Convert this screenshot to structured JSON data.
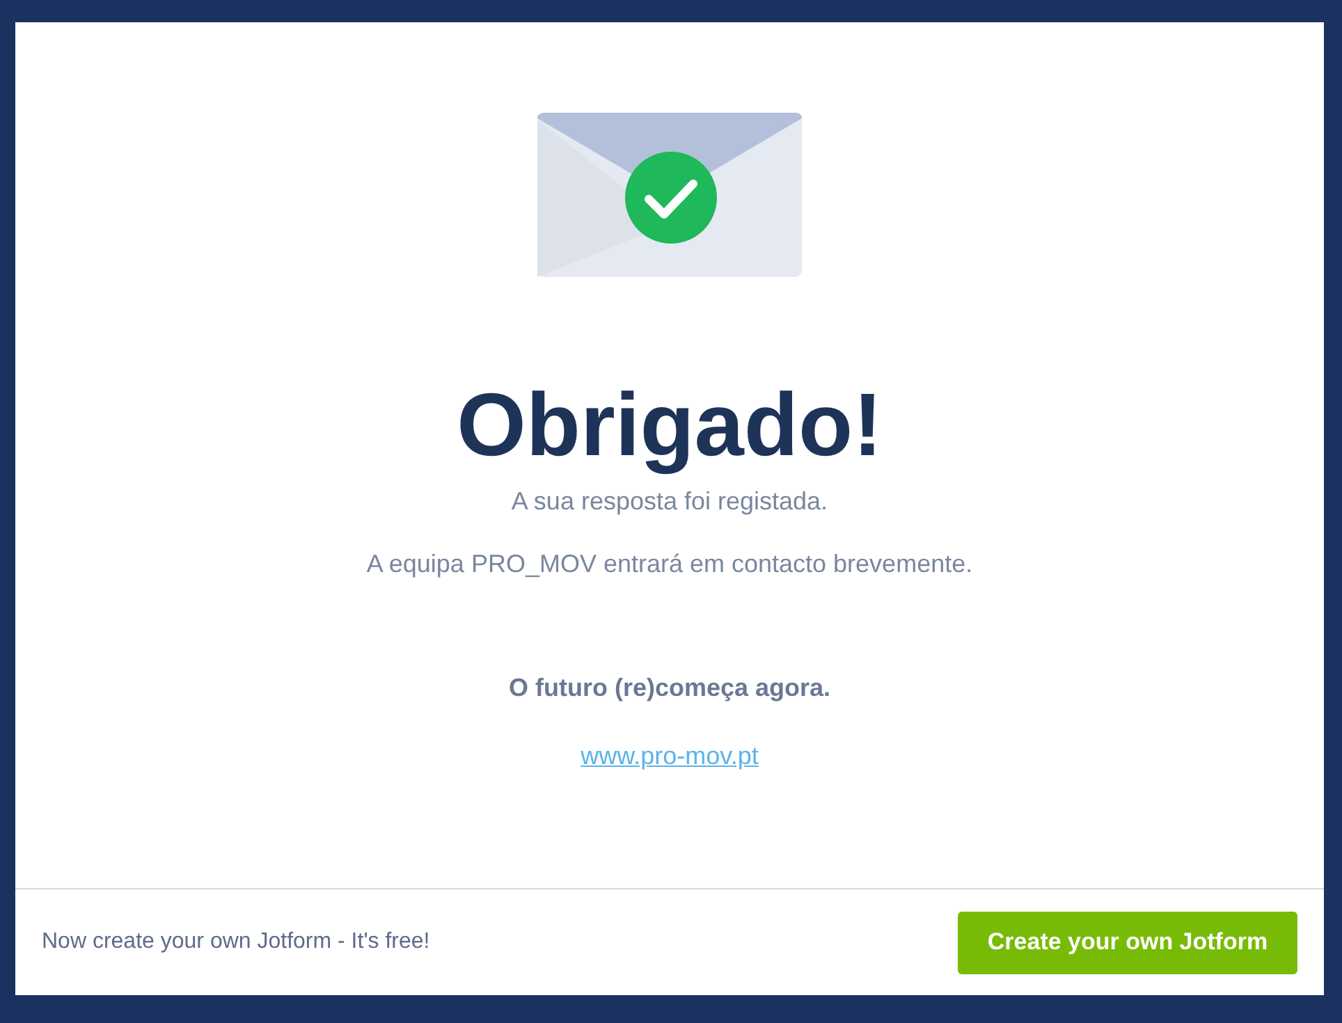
{
  "message": {
    "title": "Obrigado!",
    "lines": [
      "A sua resposta foi registada.",
      "A equipa PRO_MOV entrará em contacto brevemente."
    ],
    "tagline": "O futuro (re)começa agora.",
    "link": "www.pro-mov.pt"
  },
  "footer": {
    "text": "Now create your own Jotform - It's free!",
    "button": "Create your own Jotform"
  }
}
